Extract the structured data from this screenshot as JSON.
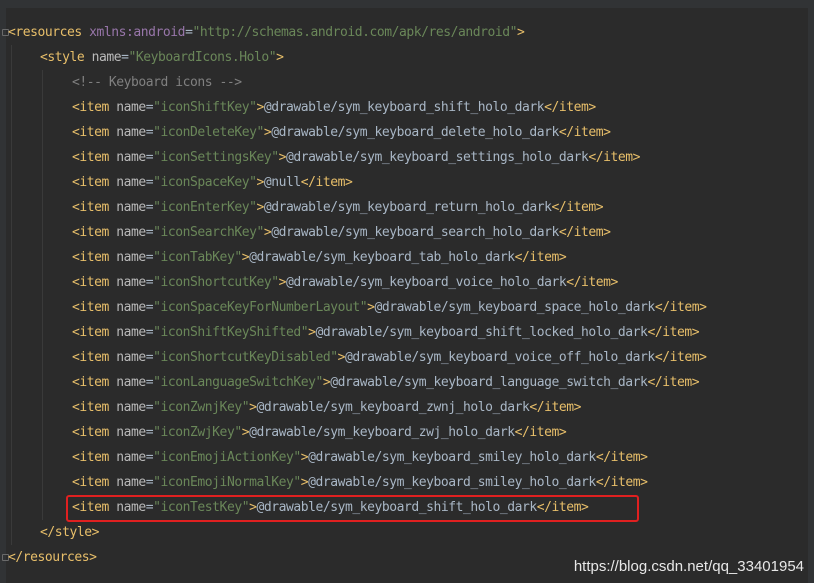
{
  "code": {
    "resources_open": {
      "open": "<resources",
      "attr": " xmlns:android",
      "eq": "=",
      "val": "\"http://schemas.android.com/apk/res/android\"",
      "close": ">"
    },
    "style_open": {
      "open": "<style",
      "attr": " name",
      "eq": "=",
      "val": "\"KeyboardIcons.Holo\"",
      "close": ">"
    },
    "comment": "<!-- Keyboard icons -->",
    "items": [
      {
        "name": "\"iconShiftKey\"",
        "value": "@drawable/sym_keyboard_shift_holo_dark"
      },
      {
        "name": "\"iconDeleteKey\"",
        "value": "@drawable/sym_keyboard_delete_holo_dark"
      },
      {
        "name": "\"iconSettingsKey\"",
        "value": "@drawable/sym_keyboard_settings_holo_dark"
      },
      {
        "name": "\"iconSpaceKey\"",
        "value": "@null"
      },
      {
        "name": "\"iconEnterKey\"",
        "value": "@drawable/sym_keyboard_return_holo_dark"
      },
      {
        "name": "\"iconSearchKey\"",
        "value": "@drawable/sym_keyboard_search_holo_dark"
      },
      {
        "name": "\"iconTabKey\"",
        "value": "@drawable/sym_keyboard_tab_holo_dark"
      },
      {
        "name": "\"iconShortcutKey\"",
        "value": "@drawable/sym_keyboard_voice_holo_dark"
      },
      {
        "name": "\"iconSpaceKeyForNumberLayout\"",
        "value": "@drawable/sym_keyboard_space_holo_dark"
      },
      {
        "name": "\"iconShiftKeyShifted\"",
        "value": "@drawable/sym_keyboard_shift_locked_holo_dark"
      },
      {
        "name": "\"iconShortcutKeyDisabled\"",
        "value": "@drawable/sym_keyboard_voice_off_holo_dark"
      },
      {
        "name": "\"iconLanguageSwitchKey\"",
        "value": "@drawable/sym_keyboard_language_switch_dark"
      },
      {
        "name": "\"iconZwnjKey\"",
        "value": "@drawable/sym_keyboard_zwnj_holo_dark"
      },
      {
        "name": "\"iconZwjKey\"",
        "value": "@drawable/sym_keyboard_zwj_holo_dark"
      },
      {
        "name": "\"iconEmojiActionKey\"",
        "value": "@drawable/sym_keyboard_smiley_holo_dark"
      },
      {
        "name": "\"iconEmojiNormalKey\"",
        "value": "@drawable/sym_keyboard_smiley_holo_dark"
      },
      {
        "name": "\"iconTestKey\"",
        "value": "@drawable/sym_keyboard_shift_holo_dark"
      }
    ],
    "item_tag": {
      "open": "<item",
      "attr": " name",
      "eq": "=",
      "gt": ">",
      "close": "</item>"
    },
    "style_close": "</style>",
    "resources_close": "</resources>"
  },
  "watermark": "https://blog.csdn.net/qq_33401954",
  "colors": {
    "background": "#2b2b2b",
    "tag": "#e8bf6a",
    "attribute": "#bababa",
    "namespace": "#9876aa",
    "string": "#6a8759",
    "text": "#a9b7c6",
    "comment": "#808080",
    "highlight": "#e02020"
  }
}
